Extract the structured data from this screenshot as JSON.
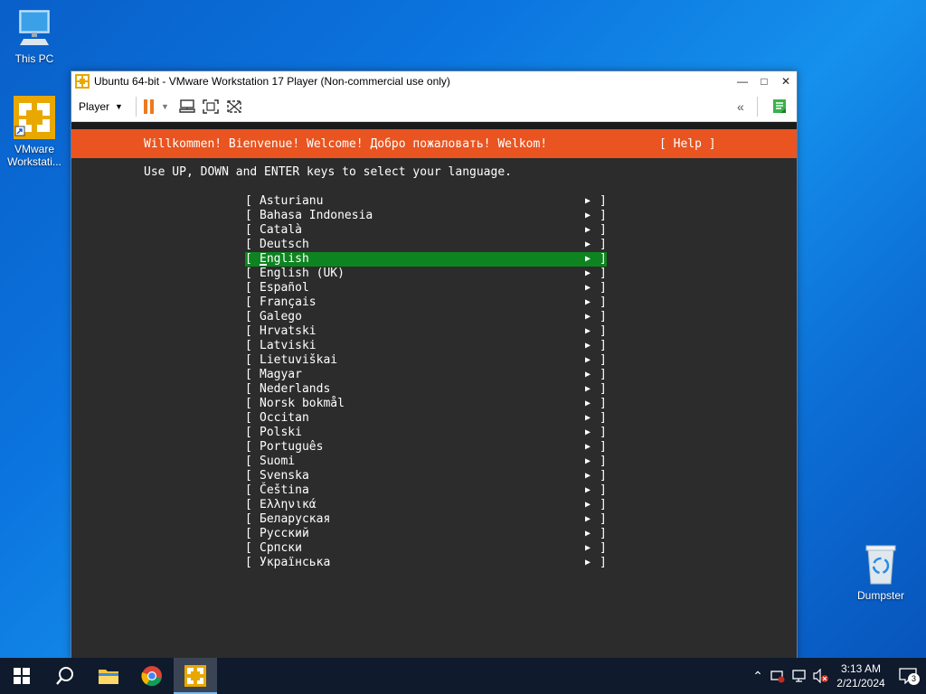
{
  "desktop": {
    "icons": [
      {
        "label": "This PC",
        "icon": "monitor-icon"
      },
      {
        "label": "VMware Workstati...",
        "icon": "vmware-icon"
      },
      {
        "label": "Dumpster",
        "icon": "recycle-bin-icon"
      }
    ]
  },
  "window": {
    "title": "Ubuntu 64-bit - VMware Workstation 17 Player (Non-commercial use only)",
    "toolbar": {
      "player_label": "Player"
    }
  },
  "installer": {
    "welcome": "Willkommen! Bienvenue! Welcome! Добро пожаловать! Welkom!",
    "help": "[ Help ]",
    "instructions": "Use UP, DOWN and ENTER keys to select your language.",
    "selected_index": 4,
    "languages": [
      "Asturianu",
      "Bahasa Indonesia",
      "Català",
      "Deutsch",
      "English",
      "English (UK)",
      "Español",
      "Français",
      "Galego",
      "Hrvatski",
      "Latviski",
      "Lietuviškai",
      "Magyar",
      "Nederlands",
      "Norsk bokmål",
      "Occitan",
      "Polski",
      "Português",
      "Suomi",
      "Svenska",
      "Čeština",
      "Ελληνικά",
      "Беларуская",
      "Русский",
      "Српски",
      "Українська"
    ]
  },
  "taskbar": {
    "time": "3:13 AM",
    "date": "2/21/2024",
    "notification_count": "3"
  },
  "colors": {
    "ubuntu_orange": "#e95420",
    "selection_green": "#0e8420",
    "terminal_bg": "#2c2c2c"
  }
}
